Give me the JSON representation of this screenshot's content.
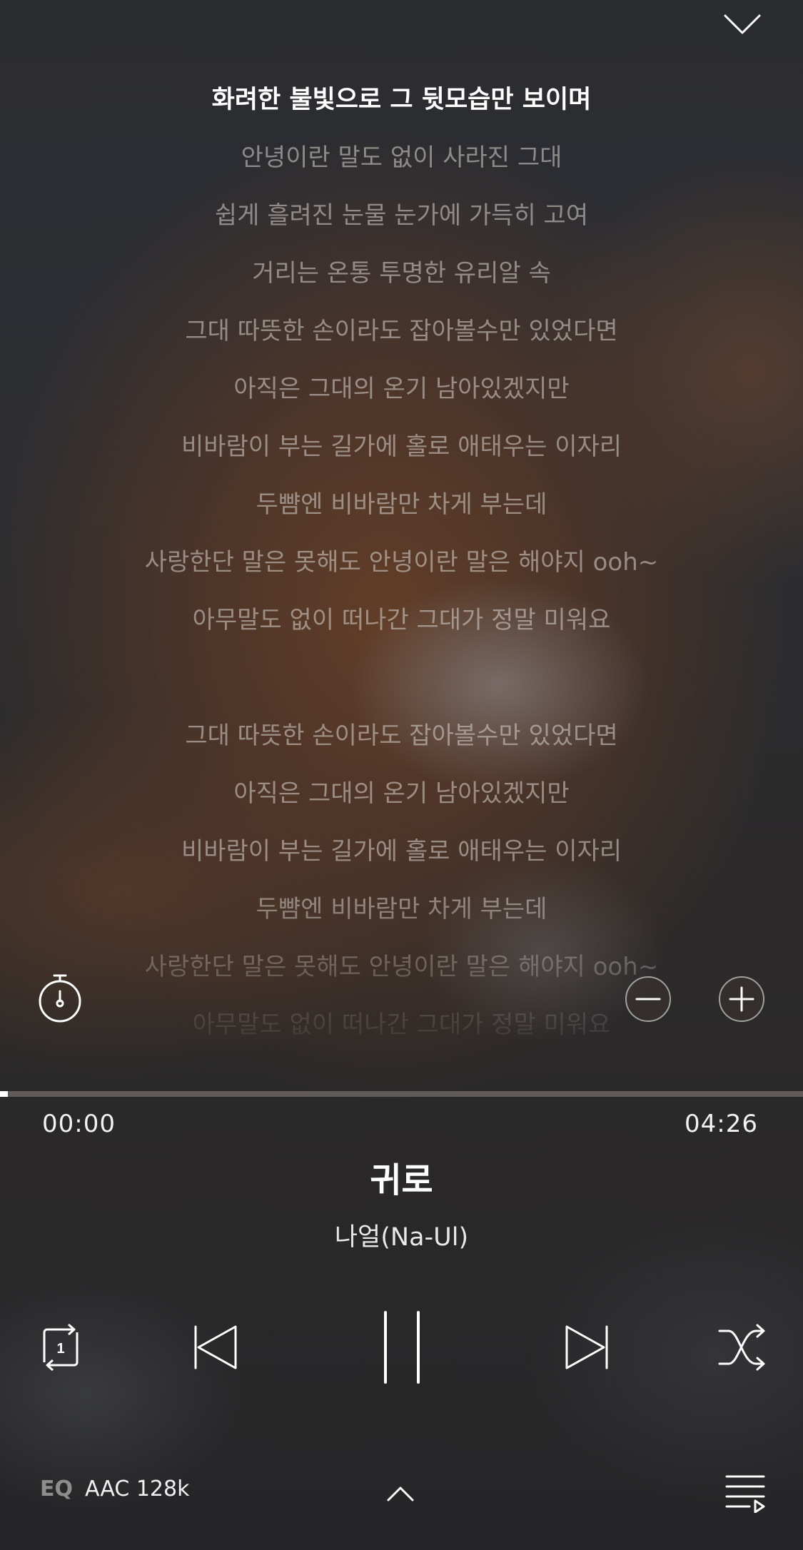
{
  "lyrics": {
    "lines": [
      "화려한 불빛으로 그 뒷모습만 보이며",
      "안녕이란 말도 없이 사라진 그대",
      "쉽게 흘려진 눈물 눈가에 가득히 고여",
      "거리는 온통 투명한 유리알 속",
      "그대 따뜻한 손이라도 잡아볼수만 있었다면",
      "아직은 그대의 온기 남아있겠지만",
      "비바람이 부는 길가에 홀로 애태우는 이자리",
      "두뺨엔 비바람만 차게 부는데",
      "사랑한단 말은 못해도 안녕이란 말은 해야지 ooh~",
      "아무말도 없이 떠나간 그대가 정말 미워요",
      "",
      "그대 따뜻한 손이라도 잡아볼수만 있었다면",
      "아직은 그대의 온기 남아있겠지만",
      "비바람이 부는 길가에 홀로 애태우는 이자리",
      "두뺨엔 비바람만 차게 부는데",
      "사랑한단 말은 못해도 안녕이란 말은 해야지 ooh~",
      "아무말도 없이 떠나간 그대가 정말 미워요"
    ],
    "current_index": 0
  },
  "player": {
    "elapsed": "00:00",
    "duration": "04:26",
    "progress_fraction": 0.01,
    "title": "귀로",
    "artist": "나얼(Na-Ul)",
    "repeat_mode_badge": "1"
  },
  "footer": {
    "eq_label": "EQ",
    "codec": "AAC 128k"
  },
  "icons": {
    "collapse": "chevron-down-icon",
    "timer": "stopwatch-icon",
    "font_smaller": "minus-circle-icon",
    "font_larger": "plus-circle-icon",
    "repeat": "repeat-one-icon",
    "previous": "skip-previous-icon",
    "pause": "pause-icon",
    "next": "skip-next-icon",
    "shuffle": "shuffle-icon",
    "expand": "chevron-up-icon",
    "playlist": "playlist-icon"
  },
  "colors": {
    "text_primary": "#ffffff",
    "lyric_inactive": "#bdb7b2",
    "progress_track": "#8c847d"
  }
}
